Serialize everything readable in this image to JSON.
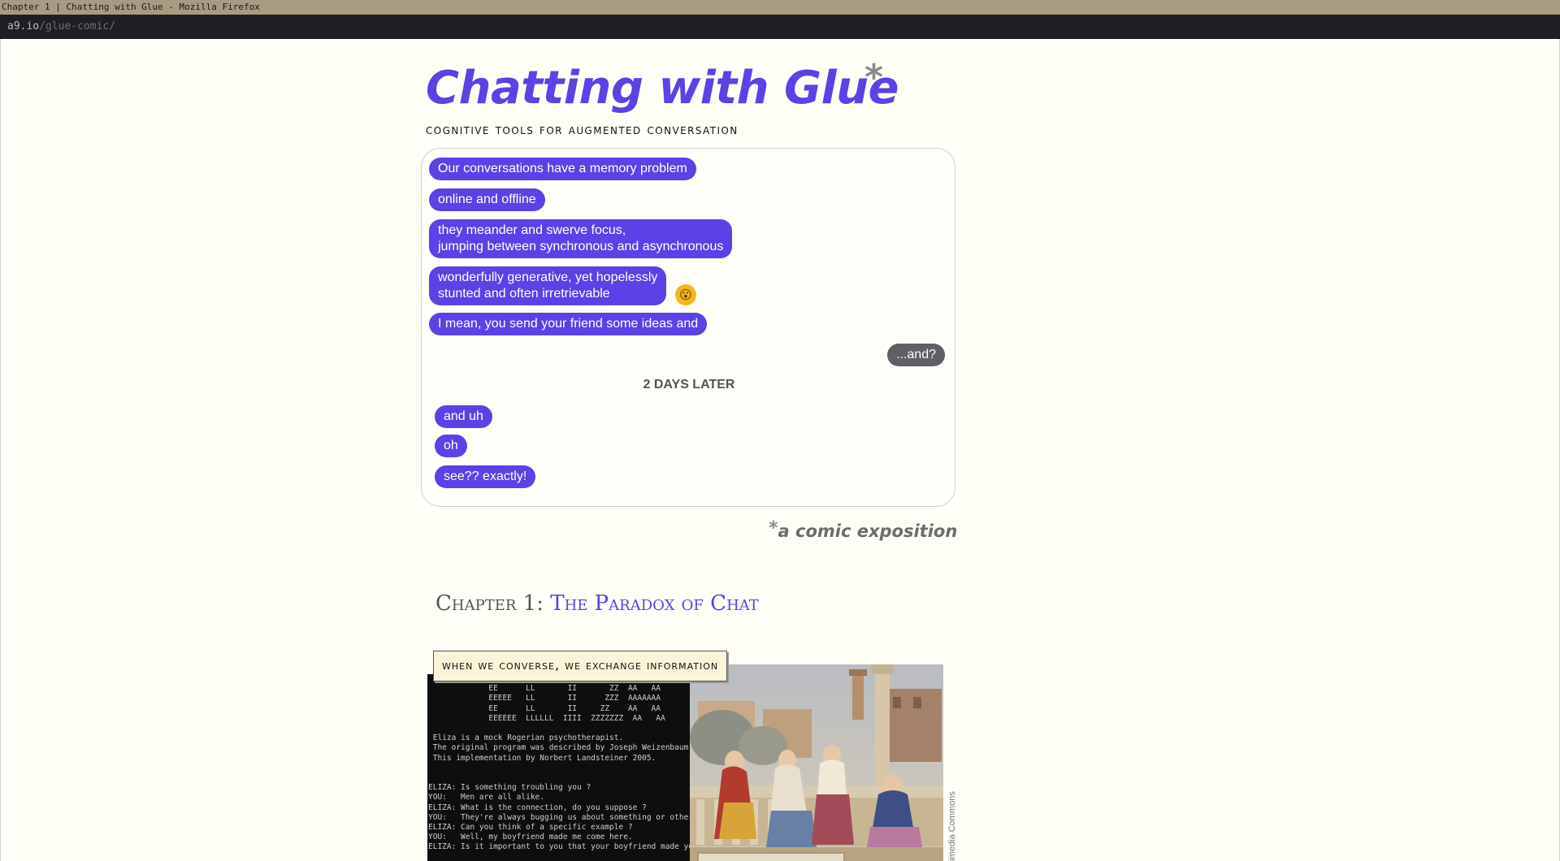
{
  "window": {
    "title": "Chapter 1 | Chatting with Glue - Mozilla Firefox"
  },
  "urlbar": {
    "host": "a9.io",
    "path": "/glue-comic/"
  },
  "header": {
    "title": "Chatting with Glue",
    "asterisk": "*",
    "subtitle": "Cognitive tools for augmented conversation"
  },
  "chat": {
    "messages": [
      {
        "text": "Our conversations have a memory problem"
      },
      {
        "text": "online and offline"
      },
      {
        "line1": "they meander and swerve focus,",
        "line2": "jumping between synchronous and asynchronous"
      },
      {
        "line1": "wonderfully generative, yet hopelessly",
        "line2": "stunted and often irretrievable",
        "reaction": "😮"
      },
      {
        "text": "I mean, you send your friend some ideas and"
      }
    ],
    "reply": "...and?",
    "divider": "2 DAYS LATER",
    "later_messages": [
      {
        "text": "and uh"
      },
      {
        "text": "oh"
      },
      {
        "text": "see?? exactly!"
      }
    ],
    "accent_color": "#5b42e6",
    "reply_color": "#5f5f66"
  },
  "comic_note": {
    "asterisk": "*",
    "text": "a comic exposition"
  },
  "chapter": {
    "number": "Chapter 1:",
    "name": "The Paradox of Chat"
  },
  "panel": {
    "caption": "When we converse, we exchange information",
    "terminal_text": "             EEEEEE  LL      IIII  ZZZZZZZ   AAAAA\n             EE      LL       II       ZZ  AA   AA\n             EEEEE   LL       II      ZZZ  AAAAAAA\n             EE      LL       II     ZZ    AA   AA\n             EEEEEE  LLLLLL  IIII  ZZZZZZZ  AA   AA\n\n Eliza is a mock Rogerian psychotherapist.\n The original program was described by Joseph Weizenbaum\n This implementation by Norbert Landsteiner 2005.\n\n\nELIZA: Is something troubling you ?\nYOU:   Men are all alike.\nELIZA: What is the connection, do you suppose ?\nYOU:   They're always bugging us about something or other.\nELIZA: Can you think of a specific example ?\nYOU:   Well, my boyfriend made me come here.\nELIZA: Is it important to you that your boyfriend made you",
    "image_credit": "Wikimedia Commons"
  }
}
